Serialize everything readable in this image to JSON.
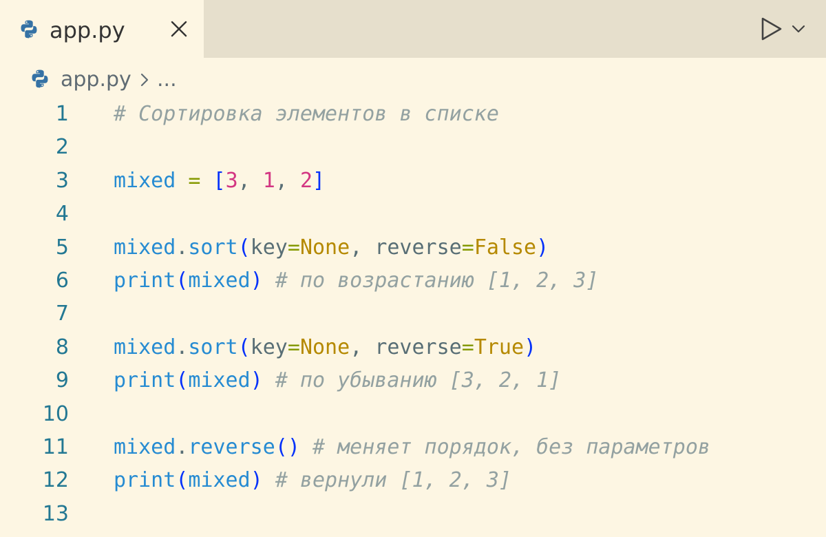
{
  "tab": {
    "filename": "app.py",
    "icon": "python-icon",
    "close_icon": "close-icon"
  },
  "toolbar": {
    "run_icon": "play-icon",
    "run_menu_icon": "chevron-down-icon"
  },
  "breadcrumb": {
    "file": "app.py",
    "separator_icon": "chevron-right-icon",
    "more": "..."
  },
  "colors": {
    "background": "#fdf6e3",
    "tabbar": "#e6dfcc",
    "line_number": "#237893",
    "comment": "#93a1a1",
    "identifier": "#268bd2",
    "operator": "#859900",
    "bracket": "#0431fa",
    "number": "#d33682",
    "constant": "#b58900"
  },
  "code": {
    "lines": [
      {
        "num": "1",
        "tokens": [
          {
            "t": "# Сортировка элементов в списке",
            "k": "comment"
          }
        ]
      },
      {
        "num": "2",
        "tokens": []
      },
      {
        "num": "3",
        "tokens": [
          {
            "t": "mixed",
            "k": "ident"
          },
          {
            "t": " ",
            "k": "punc"
          },
          {
            "t": "=",
            "k": "op"
          },
          {
            "t": " ",
            "k": "punc"
          },
          {
            "t": "[",
            "k": "bracket"
          },
          {
            "t": "3",
            "k": "num"
          },
          {
            "t": ", ",
            "k": "punc"
          },
          {
            "t": "1",
            "k": "num"
          },
          {
            "t": ", ",
            "k": "punc"
          },
          {
            "t": "2",
            "k": "num"
          },
          {
            "t": "]",
            "k": "bracket"
          }
        ]
      },
      {
        "num": "4",
        "tokens": []
      },
      {
        "num": "5",
        "tokens": [
          {
            "t": "mixed",
            "k": "ident"
          },
          {
            "t": ".",
            "k": "punc"
          },
          {
            "t": "sort",
            "k": "ident"
          },
          {
            "t": "(",
            "k": "bracket"
          },
          {
            "t": "key",
            "k": "param"
          },
          {
            "t": "=",
            "k": "op"
          },
          {
            "t": "None",
            "k": "const"
          },
          {
            "t": ", ",
            "k": "punc"
          },
          {
            "t": "reverse",
            "k": "param"
          },
          {
            "t": "=",
            "k": "op"
          },
          {
            "t": "False",
            "k": "const"
          },
          {
            "t": ")",
            "k": "bracket"
          }
        ]
      },
      {
        "num": "6",
        "tokens": [
          {
            "t": "print",
            "k": "ident"
          },
          {
            "t": "(",
            "k": "bracket"
          },
          {
            "t": "mixed",
            "k": "ident"
          },
          {
            "t": ")",
            "k": "bracket"
          },
          {
            "t": " ",
            "k": "punc"
          },
          {
            "t": "# по возрастанию [1, 2, 3]",
            "k": "comment"
          }
        ]
      },
      {
        "num": "7",
        "tokens": []
      },
      {
        "num": "8",
        "tokens": [
          {
            "t": "mixed",
            "k": "ident"
          },
          {
            "t": ".",
            "k": "punc"
          },
          {
            "t": "sort",
            "k": "ident"
          },
          {
            "t": "(",
            "k": "bracket"
          },
          {
            "t": "key",
            "k": "param"
          },
          {
            "t": "=",
            "k": "op"
          },
          {
            "t": "None",
            "k": "const"
          },
          {
            "t": ", ",
            "k": "punc"
          },
          {
            "t": "reverse",
            "k": "param"
          },
          {
            "t": "=",
            "k": "op"
          },
          {
            "t": "True",
            "k": "const"
          },
          {
            "t": ")",
            "k": "bracket"
          }
        ]
      },
      {
        "num": "9",
        "tokens": [
          {
            "t": "print",
            "k": "ident"
          },
          {
            "t": "(",
            "k": "bracket"
          },
          {
            "t": "mixed",
            "k": "ident"
          },
          {
            "t": ")",
            "k": "bracket"
          },
          {
            "t": " ",
            "k": "punc"
          },
          {
            "t": "# по убыванию [3, 2, 1]",
            "k": "comment"
          }
        ]
      },
      {
        "num": "10",
        "tokens": []
      },
      {
        "num": "11",
        "tokens": [
          {
            "t": "mixed",
            "k": "ident"
          },
          {
            "t": ".",
            "k": "punc"
          },
          {
            "t": "reverse",
            "k": "ident"
          },
          {
            "t": "()",
            "k": "bracket"
          },
          {
            "t": " ",
            "k": "punc"
          },
          {
            "t": "# меняет порядок, без параметров",
            "k": "comment"
          }
        ]
      },
      {
        "num": "12",
        "tokens": [
          {
            "t": "print",
            "k": "ident"
          },
          {
            "t": "(",
            "k": "bracket"
          },
          {
            "t": "mixed",
            "k": "ident"
          },
          {
            "t": ")",
            "k": "bracket"
          },
          {
            "t": " ",
            "k": "punc"
          },
          {
            "t": "# вернули [1, 2, 3]",
            "k": "comment"
          }
        ]
      },
      {
        "num": "13",
        "tokens": []
      }
    ]
  }
}
